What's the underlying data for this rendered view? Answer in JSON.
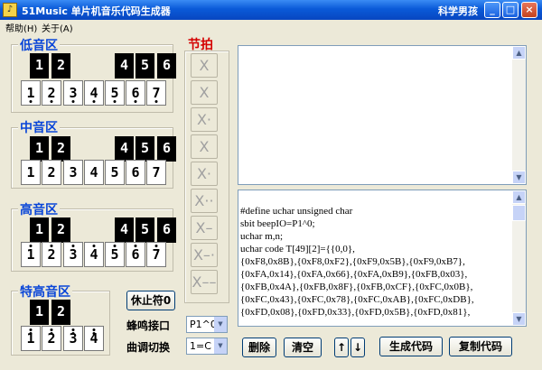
{
  "window": {
    "title": "51Music 单片机音乐代码生成器",
    "user": "科学男孩",
    "app_icon": "♪",
    "minimize": "_",
    "maximize": "□",
    "close": "×"
  },
  "menu": {
    "help": "帮助(H)",
    "about": "关于(A)"
  },
  "low": {
    "title": "低音区",
    "black": [
      "1",
      "2",
      "4",
      "5",
      "6"
    ],
    "white": [
      "1",
      "2",
      "3",
      "4",
      "5",
      "6",
      "7"
    ]
  },
  "mid": {
    "title": "中音区",
    "black": [
      "1",
      "2",
      "4",
      "5",
      "6"
    ],
    "white": [
      "1",
      "2",
      "3",
      "4",
      "5",
      "6",
      "7"
    ]
  },
  "high": {
    "title": "高音区",
    "black": [
      "1",
      "2",
      "4",
      "5",
      "6"
    ],
    "white": [
      "1",
      "2",
      "3",
      "4",
      "5",
      "6",
      "7"
    ]
  },
  "super": {
    "title": "特高音区",
    "black": [
      "1",
      "2"
    ],
    "white": [
      "1",
      "2",
      "3",
      "4"
    ]
  },
  "rest_button": "休止符0",
  "beat": {
    "title": "节拍",
    "buttons": [
      "X",
      "X",
      "X·",
      "X",
      "X·",
      "X··",
      "X–",
      "X–·",
      "X––"
    ]
  },
  "buzzer": {
    "label": "蜂鸣接口",
    "value": "P1^0"
  },
  "key_switch": {
    "label": "曲调切换",
    "value": "1=C"
  },
  "code_lines": [
    "#define uchar unsigned char",
    "sbit beepIO=P1^0;",
    "uchar m,n;",
    "uchar code T[49][2]={{0,0},",
    "{0xF8,0x8B},{0xF8,0xF2},{0xF9,0x5B},{0xF9,0xB7},",
    "{0xFA,0x14},{0xFA,0x66},{0xFA,0xB9},{0xFB,0x03},",
    "{0xFB,0x4A},{0xFB,0x8F},{0xFB,0xCF},{0xFC,0x0B},",
    "{0xFC,0x43},{0xFC,0x78},{0xFC,0xAB},{0xFC,0xDB},",
    "{0xFD,0x08},{0xFD,0x33},{0xFD,0x5B},{0xFD,0x81},"
  ],
  "buttons": {
    "delete": "删除",
    "clear": "清空",
    "up": "↑",
    "down": "↓",
    "generate": "生成代码",
    "copy": "复制代码"
  },
  "scroll": {
    "up": "▲",
    "down": "▼",
    "arrow": "▼"
  }
}
